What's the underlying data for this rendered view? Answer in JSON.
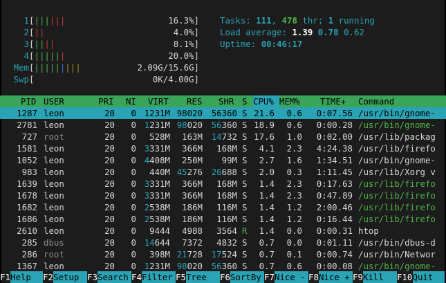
{
  "meters": [
    {
      "label": "1",
      "bars": "||||||",
      "colors": "gggrrr",
      "value": "16.3%"
    },
    {
      "label": "2",
      "bars": "||",
      "colors": "rr",
      "value": "4.0%"
    },
    {
      "label": "3",
      "bars": "||||",
      "colors": "ggrr",
      "value": "8.1%"
    },
    {
      "label": "4",
      "bars": "||||||",
      "colors": "gggggr",
      "value": "20.0%"
    },
    {
      "label": "Mem",
      "bars": "|||||||||",
      "colors": "gggggbyyy",
      "value": "2.09G/15.6G"
    },
    {
      "label": "Swp",
      "bars": "",
      "colors": "",
      "value": "0K/4.00G"
    }
  ],
  "info": {
    "tasks_label": "Tasks: ",
    "tasks": "111",
    "threads": "478",
    "thr_label": " thr; ",
    "running": "1",
    "running_label": " running",
    "load_label": "Load average: ",
    "load1": "1.39",
    "load5": "0.78",
    "load15": "0.62",
    "uptime_label": "Uptime: ",
    "uptime": "00:46:17"
  },
  "columns": [
    "PID",
    "USER",
    "PRI",
    "NI",
    "VIRT",
    "RES",
    "SHR",
    "S",
    "CPU%",
    "MEM%",
    "TIME+",
    "Command"
  ],
  "sorted_column": "CPU%",
  "processes": [
    {
      "pid": "1287",
      "user": "leon",
      "pri": "20",
      "ni": "0",
      "virt": "1231M",
      "res": "98020",
      "shr": "56360",
      "s": "S",
      "cpu": "21.6",
      "mem": "0.6",
      "time": "0:07.56",
      "cmd": "/usr/bin/gnome-"
    },
    {
      "pid": "2781",
      "user": "leon",
      "pri": "20",
      "ni": "0",
      "virt": "1231M",
      "res": "98020",
      "shr": "56360",
      "s": "S",
      "cpu": "18.9",
      "mem": "0.6",
      "time": "0:00.28",
      "cmd": "/usr/bin/gnome-"
    },
    {
      "pid": "727",
      "user": "root",
      "pri": "20",
      "ni": "0",
      "virt": "528M",
      "res": "163M",
      "shr": "14732",
      "s": "S",
      "cpu": "17.6",
      "mem": "1.0",
      "time": "0:02.00",
      "cmd": "/usr/lib/packag"
    },
    {
      "pid": "1581",
      "user": "leon",
      "pri": "20",
      "ni": "0",
      "virt": "3331M",
      "res": "366M",
      "shr": "168M",
      "s": "S",
      "cpu": "4.1",
      "mem": "2.3",
      "time": "4:24.38",
      "cmd": "/usr/lib/firefo"
    },
    {
      "pid": "1052",
      "user": "leon",
      "pri": "20",
      "ni": "0",
      "virt": "4408M",
      "res": "250M",
      "shr": "99M",
      "s": "S",
      "cpu": "2.7",
      "mem": "1.6",
      "time": "1:34.51",
      "cmd": "/usr/bin/gnome-"
    },
    {
      "pid": "983",
      "user": "leon",
      "pri": "20",
      "ni": "0",
      "virt": "440M",
      "res": "45276",
      "shr": "26688",
      "s": "S",
      "cpu": "2.0",
      "mem": "0.3",
      "time": "1:11.45",
      "cmd": "/usr/lib/Xorg v"
    },
    {
      "pid": "1639",
      "user": "leon",
      "pri": "20",
      "ni": "0",
      "virt": "3331M",
      "res": "366M",
      "shr": "168M",
      "s": "S",
      "cpu": "1.4",
      "mem": "2.3",
      "time": "0:17.63",
      "cmd": "/usr/lib/firefo"
    },
    {
      "pid": "1678",
      "user": "leon",
      "pri": "20",
      "ni": "0",
      "virt": "3331M",
      "res": "366M",
      "shr": "168M",
      "s": "S",
      "cpu": "1.4",
      "mem": "2.3",
      "time": "0:47.89",
      "cmd": "/usr/lib/firefo"
    },
    {
      "pid": "1682",
      "user": "leon",
      "pri": "20",
      "ni": "0",
      "virt": "2538M",
      "res": "186M",
      "shr": "116M",
      "s": "S",
      "cpu": "1.4",
      "mem": "1.2",
      "time": "2:00.46",
      "cmd": "/usr/lib/firefo"
    },
    {
      "pid": "1686",
      "user": "leon",
      "pri": "20",
      "ni": "0",
      "virt": "2538M",
      "res": "186M",
      "shr": "116M",
      "s": "S",
      "cpu": "1.4",
      "mem": "1.2",
      "time": "0:16.44",
      "cmd": "/usr/lib/firefo"
    },
    {
      "pid": "2610",
      "user": "leon",
      "pri": "20",
      "ni": "0",
      "virt": "9444",
      "res": "4988",
      "shr": "3564",
      "s": "R",
      "cpu": "1.4",
      "mem": "0.0",
      "time": "0:00.31",
      "cmd": "htop"
    },
    {
      "pid": "285",
      "user": "dbus",
      "pri": "20",
      "ni": "0",
      "virt": "14644",
      "res": "7372",
      "shr": "4832",
      "s": "S",
      "cpu": "0.7",
      "mem": "0.0",
      "time": "0:01.11",
      "cmd": "/usr/bin/dbus-d"
    },
    {
      "pid": "286",
      "user": "root",
      "pri": "20",
      "ni": "0",
      "virt": "398M",
      "res": "21728",
      "shr": "17524",
      "s": "S",
      "cpu": "0.7",
      "mem": "0.1",
      "time": "0:00.74",
      "cmd": "/usr/bin/Networ"
    },
    {
      "pid": "1367",
      "user": "leon",
      "pri": "20",
      "ni": "0",
      "virt": "1231M",
      "res": "98020",
      "shr": "56360",
      "s": "S",
      "cpu": "0.7",
      "mem": "0.6",
      "time": "0:00.08",
      "cmd": "/usr/bin/gnome-"
    }
  ],
  "footer": [
    {
      "key": "F1",
      "label": "Help"
    },
    {
      "key": "F2",
      "label": "Setup"
    },
    {
      "key": "F3",
      "label": "Search"
    },
    {
      "key": "F4",
      "label": "Filter"
    },
    {
      "key": "F5",
      "label": "Tree"
    },
    {
      "key": "F6",
      "label": "SortBy"
    },
    {
      "key": "F7",
      "label": "Nice -"
    },
    {
      "key": "F8",
      "label": "Nice +"
    },
    {
      "key": "F9",
      "label": "Kill"
    },
    {
      "key": "F10",
      "label": "Quit"
    }
  ],
  "colors": {
    "header_bg": "#3aa55a",
    "accent": "#2aa3b5",
    "background": "#1c1c1c"
  }
}
